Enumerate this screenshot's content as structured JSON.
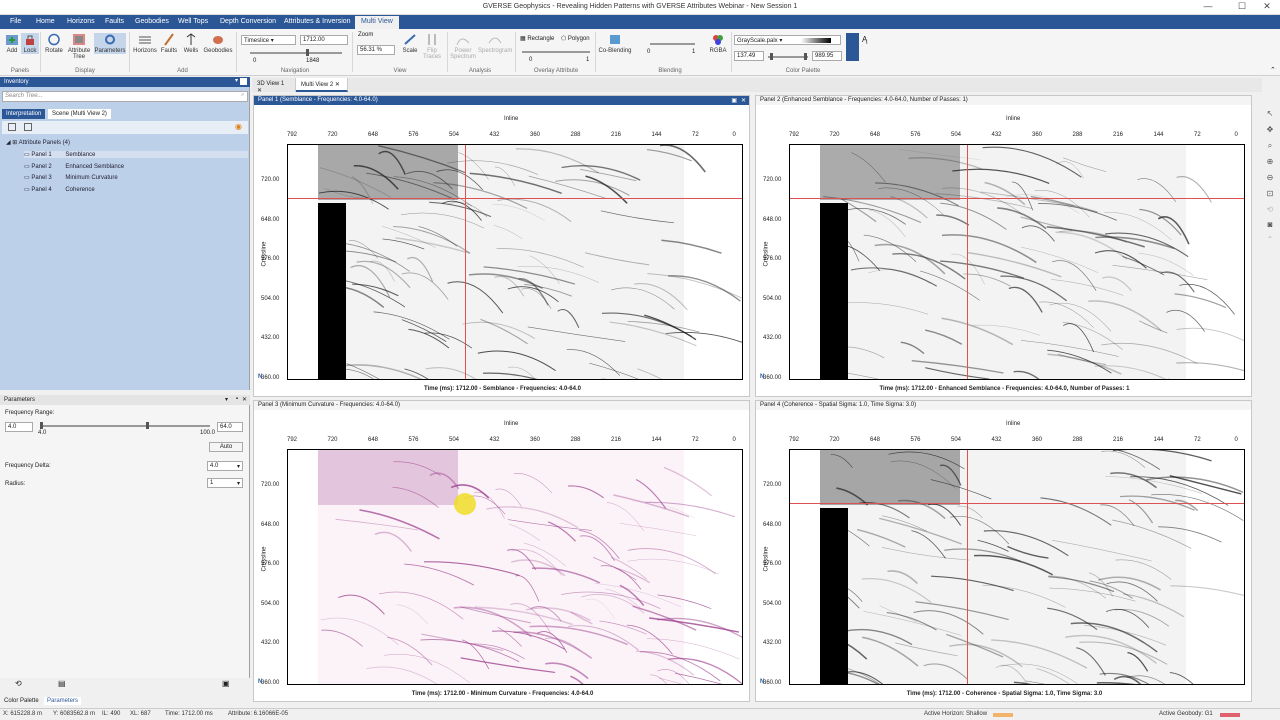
{
  "window": {
    "title": "GVERSE Geophysics - Revealing Hidden Patterns with GVERSE Attributes Webinar - New Session 1",
    "min": "—",
    "max": "☐",
    "close": "✕"
  },
  "menu": [
    "File",
    "Home",
    "Horizons",
    "Faults",
    "Geobodies",
    "Well Tops",
    "Depth Conversion",
    "Attributes & Inversion",
    "Multi View"
  ],
  "ribbon": {
    "buttons": [
      "Add",
      "Lock",
      "Rotate",
      "Attribute Tree",
      "Parameters",
      "Horizons",
      "Faults",
      "Wells",
      "Geobodies"
    ],
    "groups": [
      "Panels",
      "Display",
      "Add",
      "Navigation",
      "View",
      "Analysis",
      "Overlay Attribute",
      "Blending",
      "Color Palette"
    ],
    "navigation": {
      "mode": "Timeslice",
      "value": "1712.00",
      "min": "0",
      "max": "1848"
    },
    "zoom": {
      "label": "Zoom",
      "value": "56.31 %"
    },
    "view_buttons": [
      "Scale",
      "Flip Traces"
    ],
    "analysis": [
      "Power Spectrum",
      "Spectrogram"
    ],
    "overlay": {
      "rect": "Rectangle",
      "poly": "Polygon",
      "min": "0",
      "max": "1"
    },
    "blending": {
      "co": "Co-Blending",
      "min": "0",
      "max": "1",
      "rgba": "RGBA"
    },
    "palette": {
      "name": "GrayScale.palx",
      "min": "137.49",
      "max": "989.95"
    }
  },
  "inventory": {
    "title": "Inventory",
    "search": "Search Tree...",
    "tabs": [
      "Interpretation",
      "Scene (Multi View 2)"
    ],
    "root": "Attribute Panels (4)",
    "items": [
      {
        "panel": "Panel 1",
        "attr": "Semblance"
      },
      {
        "panel": "Panel 2",
        "attr": "Enhanced Semblance"
      },
      {
        "panel": "Panel 3",
        "attr": "Minimum Curvature"
      },
      {
        "panel": "Panel 4",
        "attr": "Coherence"
      }
    ]
  },
  "params": {
    "title": "Parameters",
    "freq_range": "Frequency Range:",
    "fmin": "4.0",
    "fmax": "64.0",
    "smin": "4.0",
    "smax": "100.0",
    "auto": "Auto",
    "freq_delta": "Frequency Delta:",
    "freq_delta_val": "4.0",
    "radius": "Radius:",
    "radius_val": "1"
  },
  "bottom_tabs": [
    "Color Palette",
    "Parameters"
  ],
  "doc_tabs": [
    "3D View 1",
    "Multi View 2"
  ],
  "xticks": [
    "792",
    "720",
    "648",
    "576",
    "504",
    "432",
    "360",
    "288",
    "216",
    "144",
    "72",
    "0"
  ],
  "yticks": [
    "720.00",
    "648.00",
    "576.00",
    "504.00",
    "432.00",
    "360.00"
  ],
  "axis_x": "Inline",
  "axis_y": "Crossline",
  "north": "N",
  "panels": [
    {
      "title": "Panel 1 (Semblance - Frequencies: 4.0-64.0)",
      "caption": "Time (ms): 1712.00 - Semblance - Frequencies: 4.0-64.0"
    },
    {
      "title": "Panel 2 (Enhanced Semblance - Frequencies: 4.0-64.0, Number of Passes: 1)",
      "caption": "Time (ms): 1712.00 - Enhanced Semblance - Frequencies: 4.0-64.0, Number of Passes: 1"
    },
    {
      "title": "Panel 3 (Minimum Curvature - Frequencies: 4.0-64.0)",
      "caption": "Time (ms): 1712.00 - Minimum Curvature - Frequencies: 4.0-64.0"
    },
    {
      "title": "Panel 4 (Coherence - Spatial Sigma: 1.0, Time Sigma: 3.0)",
      "caption": "Time (ms): 1712.00 - Coherence - Spatial Sigma: 1.0, Time Sigma: 3.0"
    }
  ],
  "status": {
    "x": "X: 615228.8 m",
    "y": "Y: 6083562.8 m",
    "il": "IL: 490",
    "xl": "XL: 687",
    "time": "Time: 1712.00 ms",
    "attr": "Attribute: 6.16066E-05",
    "horizon": "Active Horizon: Shallow",
    "geobody": "Active Geobody: G1"
  },
  "colors": {
    "accent": "#2b5797",
    "horizon": "#f2b36b",
    "geobody": "#e06070",
    "crosshair": "#e05050"
  }
}
